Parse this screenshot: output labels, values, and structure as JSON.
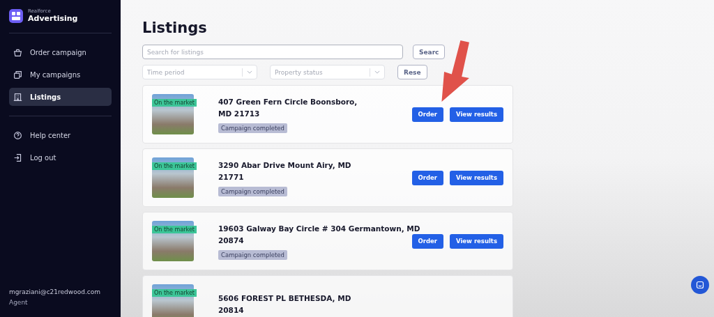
{
  "sidebar": {
    "brand": {
      "small": "Realforce",
      "name": "Advertising"
    },
    "items": [
      {
        "label": "Order campaign",
        "selected": false
      },
      {
        "label": "My campaigns",
        "selected": false
      },
      {
        "label": "Listings",
        "selected": true
      }
    ],
    "secondary_items": [
      {
        "label": "Help center"
      },
      {
        "label": "Log out"
      }
    ],
    "user": {
      "email": "mgraziani@c21redwood.com",
      "role": "Agent"
    }
  },
  "page_title": "Listings",
  "search": {
    "placeholder": "Search for listings",
    "button": "Searc"
  },
  "filters": [
    {
      "placeholder": "Time period"
    },
    {
      "placeholder": "Property status"
    }
  ],
  "reset_button": "Rese",
  "listings": [
    {
      "badge": "On the market",
      "address": [
        "407 Green Fern Circle Boonsboro,",
        "MD 21713"
      ],
      "status": "Campaign completed",
      "buttons": [
        "Order",
        "View results"
      ]
    },
    {
      "badge": "On the market",
      "address": [
        "3290 Abar Drive Mount Airy, MD",
        "21771"
      ],
      "status": "Campaign completed",
      "buttons": [
        "Order",
        "View results"
      ]
    },
    {
      "badge": "On the market",
      "address": [
        "19603 Galway Bay Circle # 304 Germantown, MD",
        "20874"
      ],
      "status": "Campaign completed",
      "buttons": [
        "Order",
        "View results"
      ]
    },
    {
      "badge": "On the market",
      "address": [
        "5606 FOREST PL BETHESDA, MD",
        "20814"
      ]
    }
  ]
}
